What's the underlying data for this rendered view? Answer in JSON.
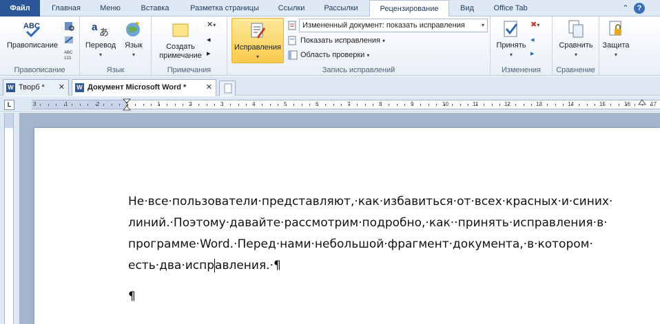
{
  "tabs": {
    "file": "Файл",
    "items": [
      "Главная",
      "Меню",
      "Вставка",
      "Разметка страницы",
      "Ссылки",
      "Рассылки",
      "Рецензирование",
      "Вид",
      "Office Tab"
    ],
    "active_index": 6
  },
  "ribbon": {
    "spelling": {
      "button": "Правописание",
      "group": "Правописание"
    },
    "language": {
      "translate": "Перевод",
      "language": "Язык",
      "group": "Язык"
    },
    "comments": {
      "create": "Создать примечание",
      "group": "Примечания"
    },
    "tracking": {
      "track_changes": "Исправления",
      "display_combo": "Измененный документ: показать исправления",
      "show_markup": "Показать исправления",
      "review_pane": "Область проверки",
      "group": "Запись исправлений"
    },
    "changes": {
      "accept": "Принять",
      "group": "Изменения"
    },
    "compare": {
      "compare": "Сравнить",
      "group": "Сравнение"
    },
    "protect": {
      "protect": "Защита"
    }
  },
  "doc_tabs": [
    {
      "label": "Творб *"
    },
    {
      "label": "Документ Microsoft Word *"
    }
  ],
  "ruler": {
    "numbers": [
      "3",
      "1",
      "2",
      "1",
      "1",
      "2",
      "3",
      "4",
      "5",
      "6",
      "7",
      "8",
      "9",
      "10",
      "11",
      "12",
      "13",
      "14",
      "15",
      "16",
      "17"
    ]
  },
  "document": {
    "line1": "Не·все·пользователи·представляют,·как·избавиться·от·всех·красных·и·синих·",
    "line2": "линий.·Поэтому·давайте·рассмотрим·подробно,·как··принять·исправления·в·",
    "line3": "программе·Word.·Перед·нами·небольшой·фрагмент·документа,·в·котором·",
    "line4_before_cursor": "есть·два·испр",
    "line4_after_cursor": "авления.·¶",
    "line5": "¶"
  },
  "colors": {
    "file_tab": "#2a5699",
    "ribbon_highlight": "#f8c94c",
    "workspace": "#a4b6cc"
  }
}
